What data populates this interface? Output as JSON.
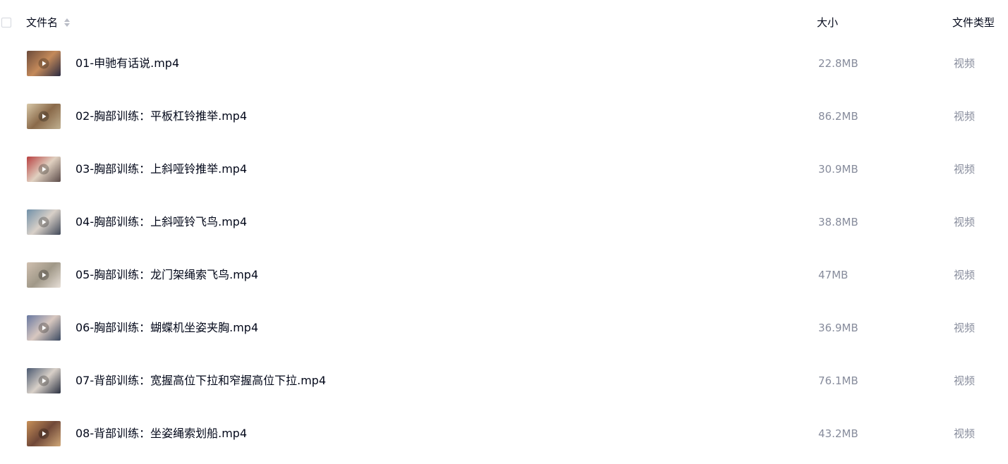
{
  "header": {
    "name_label": "文件名",
    "size_label": "大小",
    "type_label": "文件类型"
  },
  "files": [
    {
      "name": "01-申驰有话说.mp4",
      "size": "22.8MB",
      "type": "视频"
    },
    {
      "name": "02-胸部训练：平板杠铃推举.mp4",
      "size": "86.2MB",
      "type": "视频"
    },
    {
      "name": "03-胸部训练：上斜哑铃推举.mp4",
      "size": "30.9MB",
      "type": "视频"
    },
    {
      "name": "04-胸部训练：上斜哑铃飞鸟.mp4",
      "size": "38.8MB",
      "type": "视频"
    },
    {
      "name": "05-胸部训练：龙门架绳索飞鸟.mp4",
      "size": "47MB",
      "type": "视频"
    },
    {
      "name": "06-胸部训练：蝴蝶机坐姿夹胸.mp4",
      "size": "36.9MB",
      "type": "视频"
    },
    {
      "name": "07-背部训练：宽握高位下拉和窄握高位下拉.mp4",
      "size": "76.1MB",
      "type": "视频"
    },
    {
      "name": "08-背部训练：坐姿绳索划船.mp4",
      "size": "43.2MB",
      "type": "视频"
    }
  ],
  "icons": {
    "sort": "sort-icon",
    "play": "play-icon",
    "thumbnail": "video-thumbnail"
  },
  "colors": {
    "text_primary": "#03081a",
    "text_secondary": "#878c9c",
    "checkbox_border": "#d4d7de"
  }
}
